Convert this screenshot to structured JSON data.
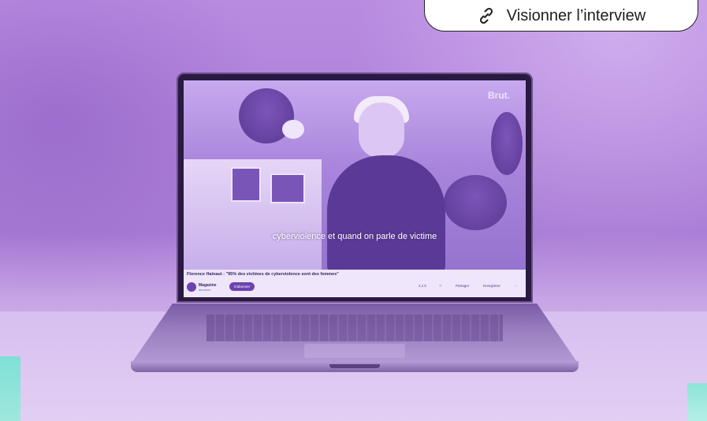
{
  "cta": {
    "icon": "link-icon",
    "label": "Visionner l’interview"
  },
  "video": {
    "channel_logo": "Brut.",
    "subtitle": "cyberviolence et quand on parle de victime",
    "title": "Florence Hainaut : \"95% des victimes de cyberviolence sont des femmes\"",
    "channel_name": "Magazine",
    "channel_subs": "abonnés",
    "subscribe_label": "S'abonner",
    "actions": [
      "4,1 k",
      "⚐",
      "Partager",
      "Enregistrer",
      "···"
    ]
  },
  "colors": {
    "accent": "#6c44b0",
    "scene_tint": "#a97dd6",
    "teal": "#8fe3d8"
  }
}
